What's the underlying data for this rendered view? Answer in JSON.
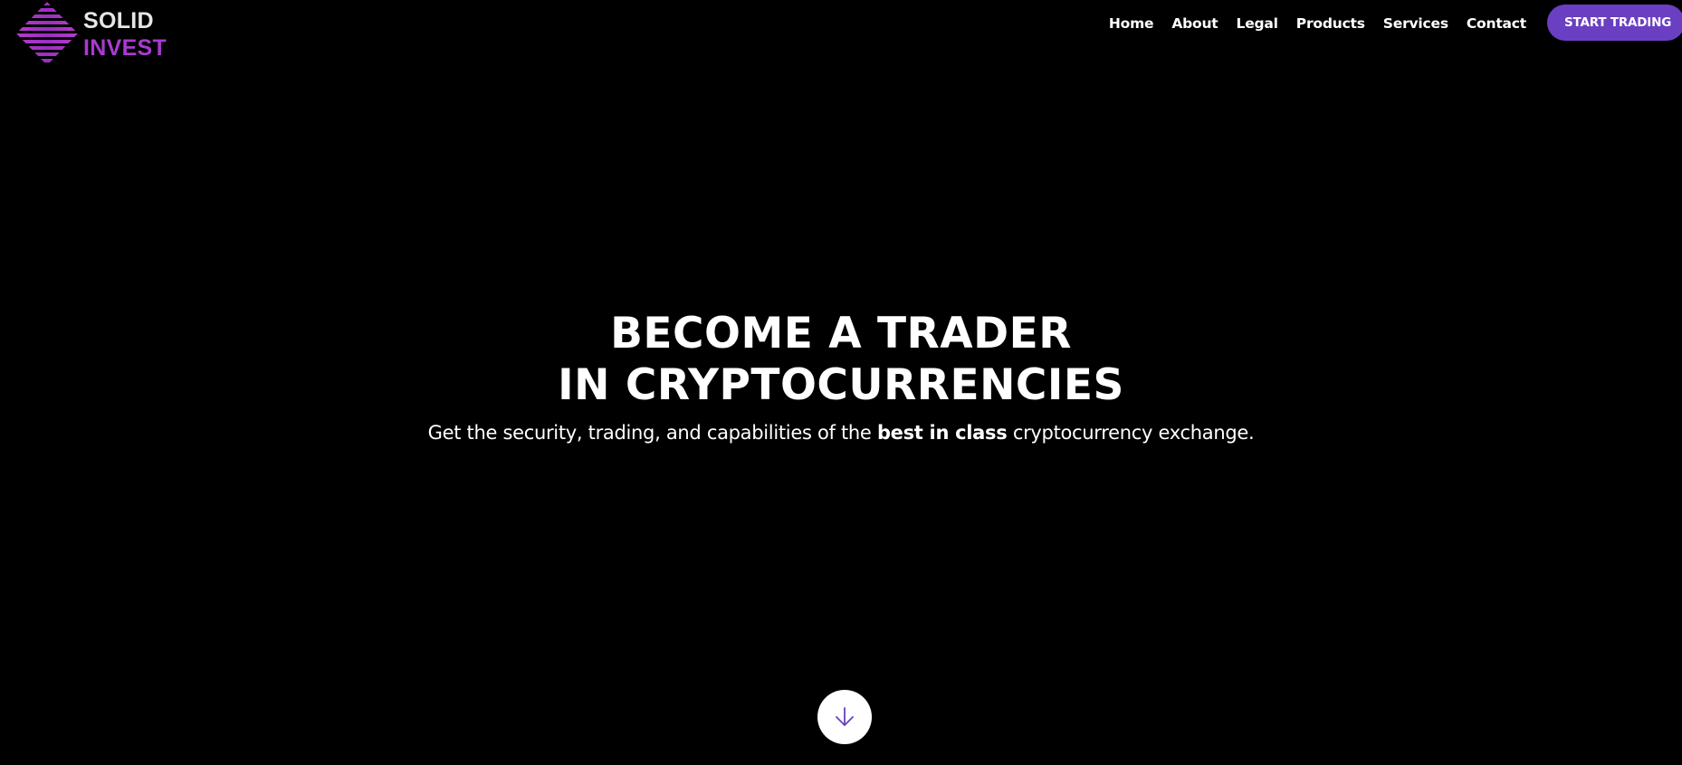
{
  "brand": {
    "line1": "SOLID",
    "line2": "INVEST",
    "logo_icon": "striped-diamond-logo-icon",
    "color_line1": "#e6e6e6",
    "color_line2": "#a93ad0"
  },
  "nav": {
    "items": [
      {
        "label": "Home"
      },
      {
        "label": "About"
      },
      {
        "label": "Legal"
      },
      {
        "label": "Products"
      },
      {
        "label": "Services"
      },
      {
        "label": "Contact"
      }
    ]
  },
  "cta": {
    "label": "START TRADING",
    "color": "#6a3fc2"
  },
  "hero": {
    "title_line1": "BECOME A TRADER",
    "title_line2": "IN CRYPTOCURRENCIES",
    "subtitle_before": "Get the security, trading, and capabilities of the ",
    "subtitle_bold": "best in class",
    "subtitle_after": " cryptocurrency exchange."
  },
  "scroll_button": {
    "icon": "arrow-down-icon",
    "icon_color": "#6a3fc2"
  },
  "colors": {
    "background": "#000000",
    "text": "#ffffff",
    "accent": "#6a3fc2",
    "brand_purple": "#a93ad0"
  }
}
